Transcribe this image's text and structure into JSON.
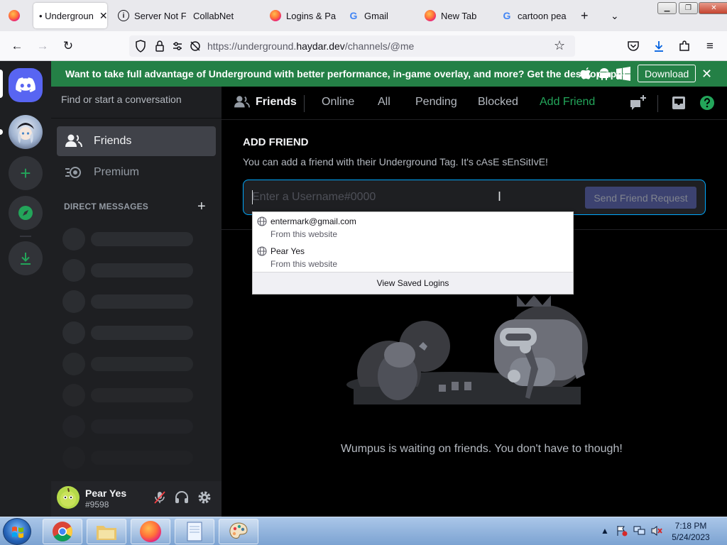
{
  "browser": {
    "tabs": [
      {
        "label": "• Undergroun",
        "active": true,
        "icon": "firefox-icon"
      },
      {
        "label": "Server Not F",
        "active": false,
        "icon": "info-icon"
      },
      {
        "label": "CollabNet",
        "active": false,
        "icon": "none"
      },
      {
        "label": "Logins & Pa",
        "active": false,
        "icon": "firefox-icon"
      },
      {
        "label": "Gmail",
        "active": false,
        "icon": "google-icon"
      },
      {
        "label": "New Tab",
        "active": false,
        "icon": "firefox-icon"
      },
      {
        "label": "cartoon pea",
        "active": false,
        "icon": "google-icon"
      }
    ],
    "url_prefix": "https://underground.",
    "url_domain": "haydar.dev",
    "url_path": "/channels/@me"
  },
  "banner": {
    "text": "Want to take full advantage of Underground with better performance, in-game overlay, and more? Get the desktop app!",
    "download_label": "Download"
  },
  "sidebar": {
    "search_placeholder": "Find or start a conversation",
    "items": [
      {
        "label": "Friends",
        "icon": "friends-icon"
      },
      {
        "label": "Premium",
        "icon": "nitro-icon"
      }
    ],
    "dm_header": "DIRECT MESSAGES"
  },
  "user": {
    "name": "Pear Yes",
    "tag": "#9598"
  },
  "topbar": {
    "title": "Friends",
    "tabs": [
      "Online",
      "All",
      "Pending",
      "Blocked"
    ],
    "add_friend": "Add Friend"
  },
  "add_friend": {
    "heading": "ADD FRIEND",
    "description": "You can add a friend with their Underground Tag. It's cAsE sEnSitIvE!",
    "placeholder": "Enter a Username#0000",
    "value": "",
    "button": "Send Friend Request"
  },
  "autocomplete": {
    "items": [
      {
        "login": "entermark@gmail.com",
        "source": "From this website"
      },
      {
        "login": "Pear Yes",
        "source": "From this website"
      }
    ],
    "footer": "View Saved Logins"
  },
  "empty_state": "Wumpus is waiting on friends. You don't have to though!",
  "taskbar": {
    "time": "7:18 PM",
    "date": "5/24/2023"
  },
  "colors": {
    "blurple": "#5865f2",
    "banner_green": "#248046",
    "add_friend_green": "#23a55a",
    "input_focus": "#00a8fc"
  }
}
